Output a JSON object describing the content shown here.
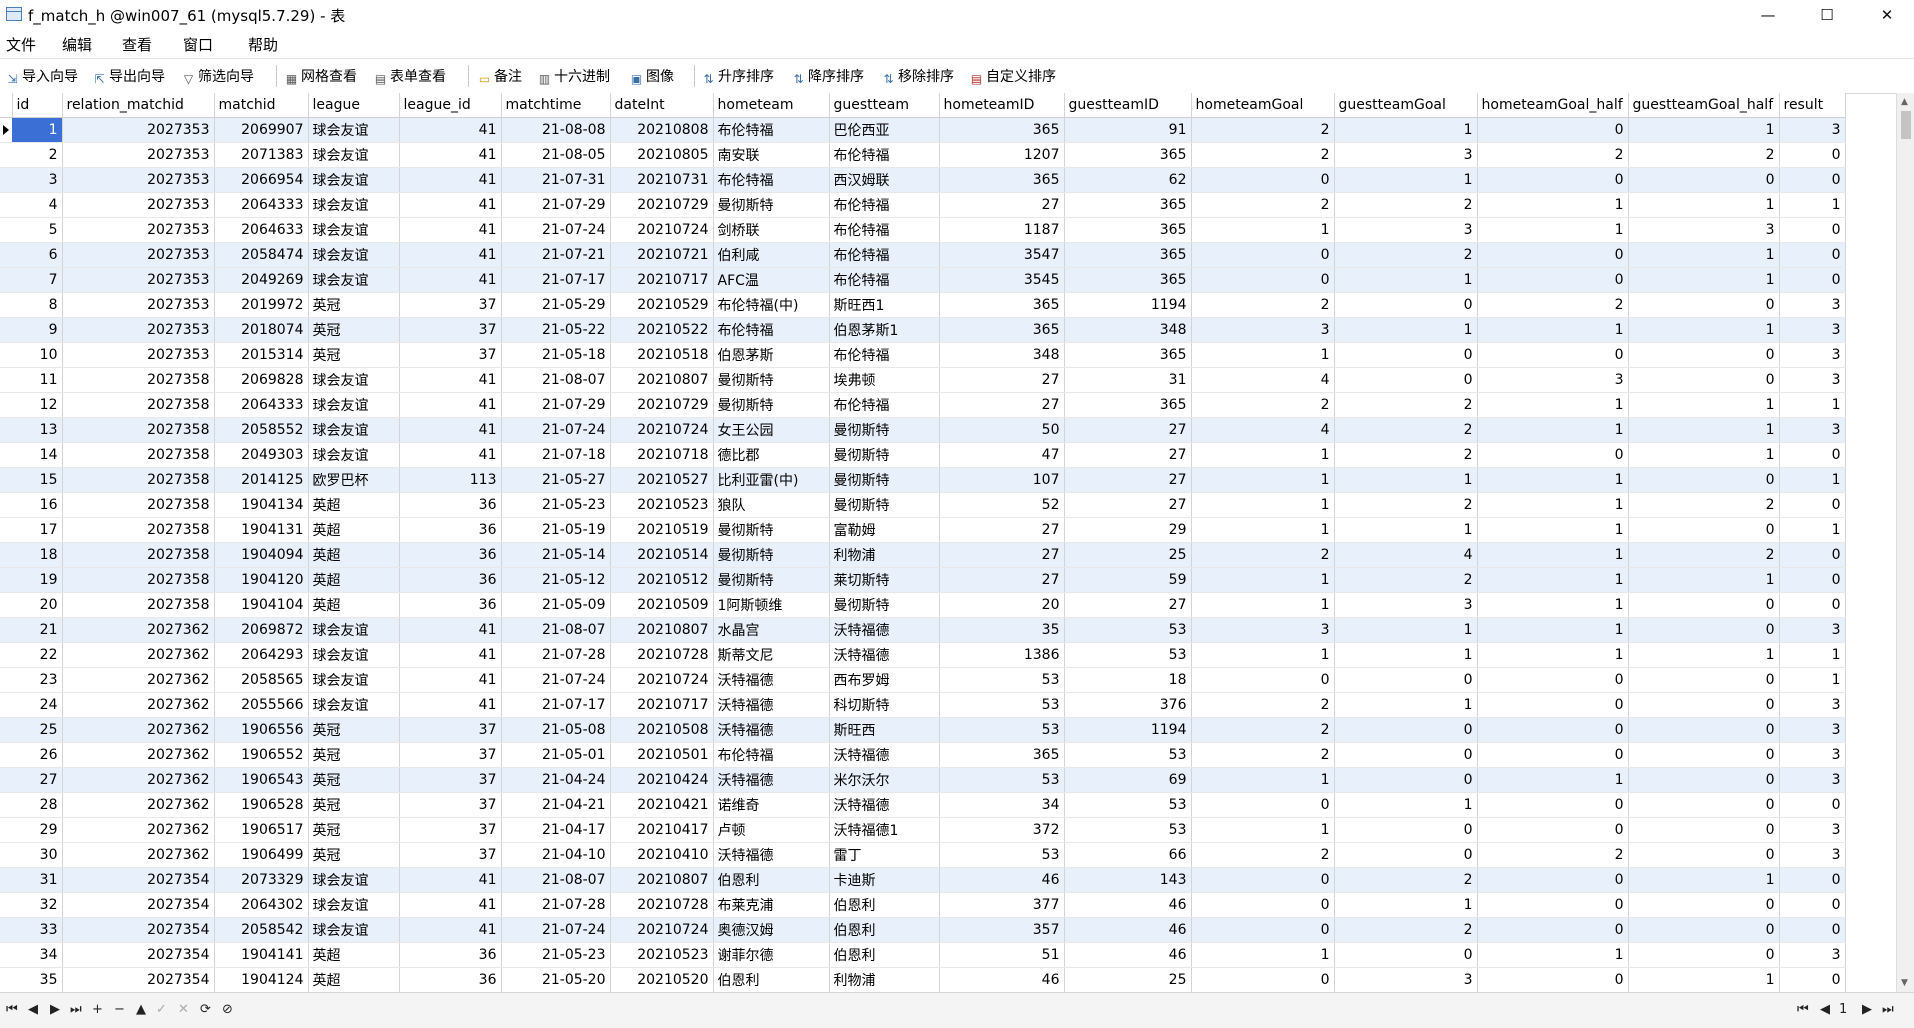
{
  "window": {
    "title": "f_match_h @win007_61 (mysql5.7.29) - 表",
    "minimize_icon": "—",
    "maximize_icon": "☐",
    "close_icon": "✕"
  },
  "menu": [
    "文件",
    "编辑",
    "查看",
    "窗口",
    "帮助"
  ],
  "toolbar": {
    "import_wizard": "导入向导",
    "export_wizard": "导出向导",
    "filter_wizard": "筛选向导",
    "grid_view": "网格查看",
    "form_view": "表单查看",
    "memo": "备注",
    "hex": "十六进制",
    "image": "图像",
    "sort_asc": "升序排序",
    "sort_desc": "降序排序",
    "remove_sort": "移除排序",
    "custom_sort": "自定义排序"
  },
  "grid": {
    "columns": [
      "id",
      "relation_matchid",
      "matchid",
      "league",
      "league_id",
      "matchtime",
      "dateInt",
      "hometeam",
      "guestteam",
      "hometeamID",
      "guestteamID",
      "hometeamGoal",
      "guestteamGoal",
      "hometeamGoal_half",
      "guestteamGoal_half",
      "result"
    ],
    "rows": [
      [
        "1",
        "2027353",
        "2069907",
        "球会友谊",
        "41",
        "21-08-08",
        "20210808",
        "布伦特福",
        "巴伦西亚",
        "365",
        "91",
        "2",
        "1",
        "0",
        "1",
        "3"
      ],
      [
        "2",
        "2027353",
        "2071383",
        "球会友谊",
        "41",
        "21-08-05",
        "20210805",
        "南安联",
        "布伦特福",
        "1207",
        "365",
        "2",
        "3",
        "2",
        "2",
        "0"
      ],
      [
        "3",
        "2027353",
        "2066954",
        "球会友谊",
        "41",
        "21-07-31",
        "20210731",
        "布伦特福",
        "西汉姆联",
        "365",
        "62",
        "0",
        "1",
        "0",
        "0",
        "0"
      ],
      [
        "4",
        "2027353",
        "2064333",
        "球会友谊",
        "41",
        "21-07-29",
        "20210729",
        "曼彻斯特",
        "布伦特福",
        "27",
        "365",
        "2",
        "2",
        "1",
        "1",
        "1"
      ],
      [
        "5",
        "2027353",
        "2064633",
        "球会友谊",
        "41",
        "21-07-24",
        "20210724",
        "剑桥联",
        "布伦特福",
        "1187",
        "365",
        "1",
        "3",
        "1",
        "3",
        "0"
      ],
      [
        "6",
        "2027353",
        "2058474",
        "球会友谊",
        "41",
        "21-07-21",
        "20210721",
        "伯利咸",
        "布伦特福",
        "3547",
        "365",
        "0",
        "2",
        "0",
        "1",
        "0"
      ],
      [
        "7",
        "2027353",
        "2049269",
        "球会友谊",
        "41",
        "21-07-17",
        "20210717",
        "AFC温",
        "布伦特福",
        "3545",
        "365",
        "0",
        "1",
        "0",
        "1",
        "0"
      ],
      [
        "8",
        "2027353",
        "2019972",
        "英冠",
        "37",
        "21-05-29",
        "20210529",
        "布伦特福(中)",
        "斯旺西1",
        "365",
        "1194",
        "2",
        "0",
        "2",
        "0",
        "3"
      ],
      [
        "9",
        "2027353",
        "2018074",
        "英冠",
        "37",
        "21-05-22",
        "20210522",
        "布伦特福",
        "伯恩茅斯1",
        "365",
        "348",
        "3",
        "1",
        "1",
        "1",
        "3"
      ],
      [
        "10",
        "2027353",
        "2015314",
        "英冠",
        "37",
        "21-05-18",
        "20210518",
        "伯恩茅斯",
        "布伦特福",
        "348",
        "365",
        "1",
        "0",
        "0",
        "0",
        "3"
      ],
      [
        "11",
        "2027358",
        "2069828",
        "球会友谊",
        "41",
        "21-08-07",
        "20210807",
        "曼彻斯特",
        "埃弗顿",
        "27",
        "31",
        "4",
        "0",
        "3",
        "0",
        "3"
      ],
      [
        "12",
        "2027358",
        "2064333",
        "球会友谊",
        "41",
        "21-07-29",
        "20210729",
        "曼彻斯特",
        "布伦特福",
        "27",
        "365",
        "2",
        "2",
        "1",
        "1",
        "1"
      ],
      [
        "13",
        "2027358",
        "2058552",
        "球会友谊",
        "41",
        "21-07-24",
        "20210724",
        "女王公园",
        "曼彻斯特",
        "50",
        "27",
        "4",
        "2",
        "1",
        "1",
        "3"
      ],
      [
        "14",
        "2027358",
        "2049303",
        "球会友谊",
        "41",
        "21-07-18",
        "20210718",
        "德比郡",
        "曼彻斯特",
        "47",
        "27",
        "1",
        "2",
        "0",
        "1",
        "0"
      ],
      [
        "15",
        "2027358",
        "2014125",
        "欧罗巴杯",
        "113",
        "21-05-27",
        "20210527",
        "比利亚雷(中)",
        "曼彻斯特",
        "107",
        "27",
        "1",
        "1",
        "1",
        "0",
        "1"
      ],
      [
        "16",
        "2027358",
        "1904134",
        "英超",
        "36",
        "21-05-23",
        "20210523",
        "狼队",
        "曼彻斯特",
        "52",
        "27",
        "1",
        "2",
        "1",
        "2",
        "0"
      ],
      [
        "17",
        "2027358",
        "1904131",
        "英超",
        "36",
        "21-05-19",
        "20210519",
        "曼彻斯特",
        "富勒姆",
        "27",
        "29",
        "1",
        "1",
        "1",
        "0",
        "1"
      ],
      [
        "18",
        "2027358",
        "1904094",
        "英超",
        "36",
        "21-05-14",
        "20210514",
        "曼彻斯特",
        "利物浦",
        "27",
        "25",
        "2",
        "4",
        "1",
        "2",
        "0"
      ],
      [
        "19",
        "2027358",
        "1904120",
        "英超",
        "36",
        "21-05-12",
        "20210512",
        "曼彻斯特",
        "莱切斯特",
        "27",
        "59",
        "1",
        "2",
        "1",
        "1",
        "0"
      ],
      [
        "20",
        "2027358",
        "1904104",
        "英超",
        "36",
        "21-05-09",
        "20210509",
        "1阿斯顿维",
        "曼彻斯特",
        "20",
        "27",
        "1",
        "3",
        "1",
        "0",
        "0"
      ],
      [
        "21",
        "2027362",
        "2069872",
        "球会友谊",
        "41",
        "21-08-07",
        "20210807",
        "水晶宫",
        "沃特福德",
        "35",
        "53",
        "3",
        "1",
        "1",
        "0",
        "3"
      ],
      [
        "22",
        "2027362",
        "2064293",
        "球会友谊",
        "41",
        "21-07-28",
        "20210728",
        "斯蒂文尼",
        "沃特福德",
        "1386",
        "53",
        "1",
        "1",
        "1",
        "1",
        "1"
      ],
      [
        "23",
        "2027362",
        "2058565",
        "球会友谊",
        "41",
        "21-07-24",
        "20210724",
        "沃特福德",
        "西布罗姆",
        "53",
        "18",
        "0",
        "0",
        "0",
        "0",
        "1"
      ],
      [
        "24",
        "2027362",
        "2055566",
        "球会友谊",
        "41",
        "21-07-17",
        "20210717",
        "沃特福德",
        "科切斯特",
        "53",
        "376",
        "2",
        "1",
        "0",
        "0",
        "3"
      ],
      [
        "25",
        "2027362",
        "1906556",
        "英冠",
        "37",
        "21-05-08",
        "20210508",
        "沃特福德",
        "斯旺西",
        "53",
        "1194",
        "2",
        "0",
        "0",
        "0",
        "3"
      ],
      [
        "26",
        "2027362",
        "1906552",
        "英冠",
        "37",
        "21-05-01",
        "20210501",
        "布伦特福",
        "沃特福德",
        "365",
        "53",
        "2",
        "0",
        "0",
        "0",
        "3"
      ],
      [
        "27",
        "2027362",
        "1906543",
        "英冠",
        "37",
        "21-04-24",
        "20210424",
        "沃特福德",
        "米尔沃尔",
        "53",
        "69",
        "1",
        "0",
        "1",
        "0",
        "3"
      ],
      [
        "28",
        "2027362",
        "1906528",
        "英冠",
        "37",
        "21-04-21",
        "20210421",
        "诺维奇",
        "沃特福德",
        "34",
        "53",
        "0",
        "1",
        "0",
        "0",
        "0"
      ],
      [
        "29",
        "2027362",
        "1906517",
        "英冠",
        "37",
        "21-04-17",
        "20210417",
        "卢顿",
        "沃特福德1",
        "372",
        "53",
        "1",
        "0",
        "0",
        "0",
        "3"
      ],
      [
        "30",
        "2027362",
        "1906499",
        "英冠",
        "37",
        "21-04-10",
        "20210410",
        "沃特福德",
        "雷丁",
        "53",
        "66",
        "2",
        "0",
        "2",
        "0",
        "3"
      ],
      [
        "31",
        "2027354",
        "2073329",
        "球会友谊",
        "41",
        "21-08-07",
        "20210807",
        "伯恩利",
        "卡迪斯",
        "46",
        "143",
        "0",
        "2",
        "0",
        "1",
        "0"
      ],
      [
        "32",
        "2027354",
        "2064302",
        "球会友谊",
        "41",
        "21-07-28",
        "20210728",
        "布莱克浦",
        "伯恩利",
        "377",
        "46",
        "0",
        "1",
        "0",
        "0",
        "0"
      ],
      [
        "33",
        "2027354",
        "2058542",
        "球会友谊",
        "41",
        "21-07-24",
        "20210724",
        "奥德汉姆",
        "伯恩利",
        "357",
        "46",
        "0",
        "2",
        "0",
        "0",
        "0"
      ],
      [
        "34",
        "2027354",
        "1904141",
        "英超",
        "36",
        "21-05-23",
        "20210523",
        "谢菲尔德",
        "伯恩利",
        "51",
        "46",
        "1",
        "0",
        "1",
        "0",
        "3"
      ],
      [
        "35",
        "2027354",
        "1904124",
        "英超",
        "36",
        "21-05-20",
        "20210520",
        "伯恩利",
        "利物浦",
        "46",
        "25",
        "0",
        "3",
        "0",
        "1",
        "0"
      ]
    ],
    "selected_row_id": "1"
  },
  "statusbar": {
    "first": "⏮",
    "prev": "◀",
    "next": "▶",
    "last": "⏭",
    "add": "+",
    "delete": "−",
    "apply": "▲",
    "undo": "✓",
    "cancel": "✕",
    "refresh": "⟳",
    "stop": "⊘",
    "page_first": "⏮",
    "page_prev": "◀",
    "page_number": "1",
    "page_next": "▶",
    "page_last": "⏭"
  },
  "colors": {
    "selection": "#3b6fd6",
    "alt_row": "#e8f1fb"
  }
}
